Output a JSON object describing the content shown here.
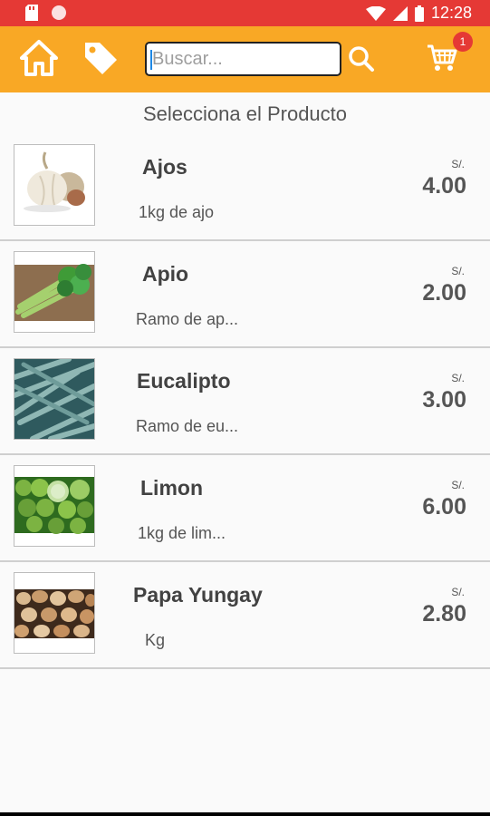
{
  "status": {
    "time": "12:28"
  },
  "search": {
    "placeholder": "Buscar..."
  },
  "cart": {
    "count": "1"
  },
  "heading": "Selecciona el Producto",
  "products": [
    {
      "name": "Ajos",
      "description": "1kg de ajo",
      "currency": "S/.",
      "price": "4.00",
      "image": "garlic"
    },
    {
      "name": "Apio",
      "description": "Ramo de ap...",
      "currency": "S/.",
      "price": "2.00",
      "image": "celery"
    },
    {
      "name": "Eucalipto",
      "description": "Ramo de eu...",
      "currency": "S/.",
      "price": "3.00",
      "image": "eucalyptus"
    },
    {
      "name": "Limon",
      "description": "1kg de lim...",
      "currency": "S/.",
      "price": "6.00",
      "image": "limes"
    },
    {
      "name": "Papa Yungay",
      "description": "Kg",
      "currency": "S/.",
      "price": "2.80",
      "image": "potatoes"
    }
  ],
  "colors": {
    "statusbar": "#e53935",
    "toolbar": "#f9a825",
    "badge": "#e53935"
  }
}
